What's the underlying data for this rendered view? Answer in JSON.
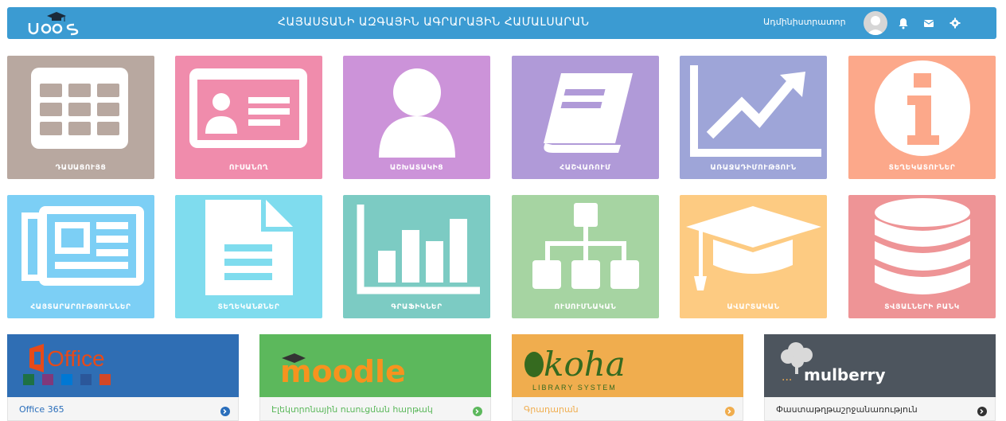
{
  "header": {
    "logo_text": "ՍԹՖՏ",
    "title": "ՀԱՅԱՍՏԱՆԻ ԱԶԳԱՅԻՆ ԱԳՐԱՐԱՅԻՆ ՀԱՄԱԼՍԱՐԱՆ",
    "user_name": "Ադմինիստրատոր",
    "icons": [
      "avatar-icon",
      "bell-icon",
      "envelope-icon",
      "gear-icon"
    ]
  },
  "tiles": [
    {
      "label": "ԴԱՍԱՑՈՒՅՑ",
      "icon": "calendar-grid-icon",
      "color": "#b8a8a0"
    },
    {
      "label": "ՈՒՍԱՆՈՂ",
      "icon": "id-card-icon",
      "color": "#f08cac"
    },
    {
      "label": "ԱՇԽԱՏԱԿԻՑ",
      "icon": "user-icon",
      "color": "#cc93d9"
    },
    {
      "label": "ՀԱՇՎԱՌՈՒՄ",
      "icon": "book-icon",
      "color": "#b09ad8"
    },
    {
      "label": "ԱՌԱՋԱԴԻՄՈՒԹՅՈՒՆ",
      "icon": "trend-chart-icon",
      "color": "#9ea5d8"
    },
    {
      "label": "ՏԵՂԵԿԱՏՈՒՆԵՐ",
      "icon": "info-icon",
      "color": "#fca88a"
    },
    {
      "label": "ՀԱՅՏԱՐԱՐՈՒԹՅՈՒՆՆԵՐ",
      "icon": "newspaper-icon",
      "color": "#7ccff5"
    },
    {
      "label": "ՏԵՂԵԿԱՆՔՆԵՐ",
      "icon": "document-icon",
      "color": "#7fdcee"
    },
    {
      "label": "ԳՐԱՖԻԿՆԵՐ",
      "icon": "bar-chart-icon",
      "color": "#7ccbc3"
    },
    {
      "label": "ՈՒՍՈՒՄՆԱԿԱՆ",
      "icon": "sitemap-icon",
      "color": "#a6d4a2"
    },
    {
      "label": "ԱՎԱՐՏԱԿԱՆ",
      "icon": "graduation-cap-icon",
      "color": "#fdcb82"
    },
    {
      "label": "ՏՎՅԱԼՆԵՐԻ ԲԱՆԿ",
      "icon": "database-icon",
      "color": "#ee9496"
    }
  ],
  "cards": [
    {
      "brand": "Office",
      "caption": "Office 365",
      "banner_color": "#2f6eb4",
      "caption_color": "#2a6ebb",
      "go_color": "#2a6ebb"
    },
    {
      "brand": "moodle",
      "caption": "Էլեկտրոնային ուսուցման հարթակ",
      "banner_color": "#5cb85c",
      "caption_color": "#5cb85c",
      "go_color": "#5cb85c"
    },
    {
      "brand": "koha",
      "brand_sub": "LIBRARY SYSTEM",
      "caption": "Գրադարան",
      "banner_color": "#f0ad4e",
      "caption_color": "#f0ad4e",
      "go_color": "#f0ad4e"
    },
    {
      "brand": "mulberry",
      "caption": "Փաստաթղթաշրջանառություն",
      "banner_color": "#4d555e",
      "caption_color": "#333333",
      "go_color": "#333333"
    }
  ]
}
